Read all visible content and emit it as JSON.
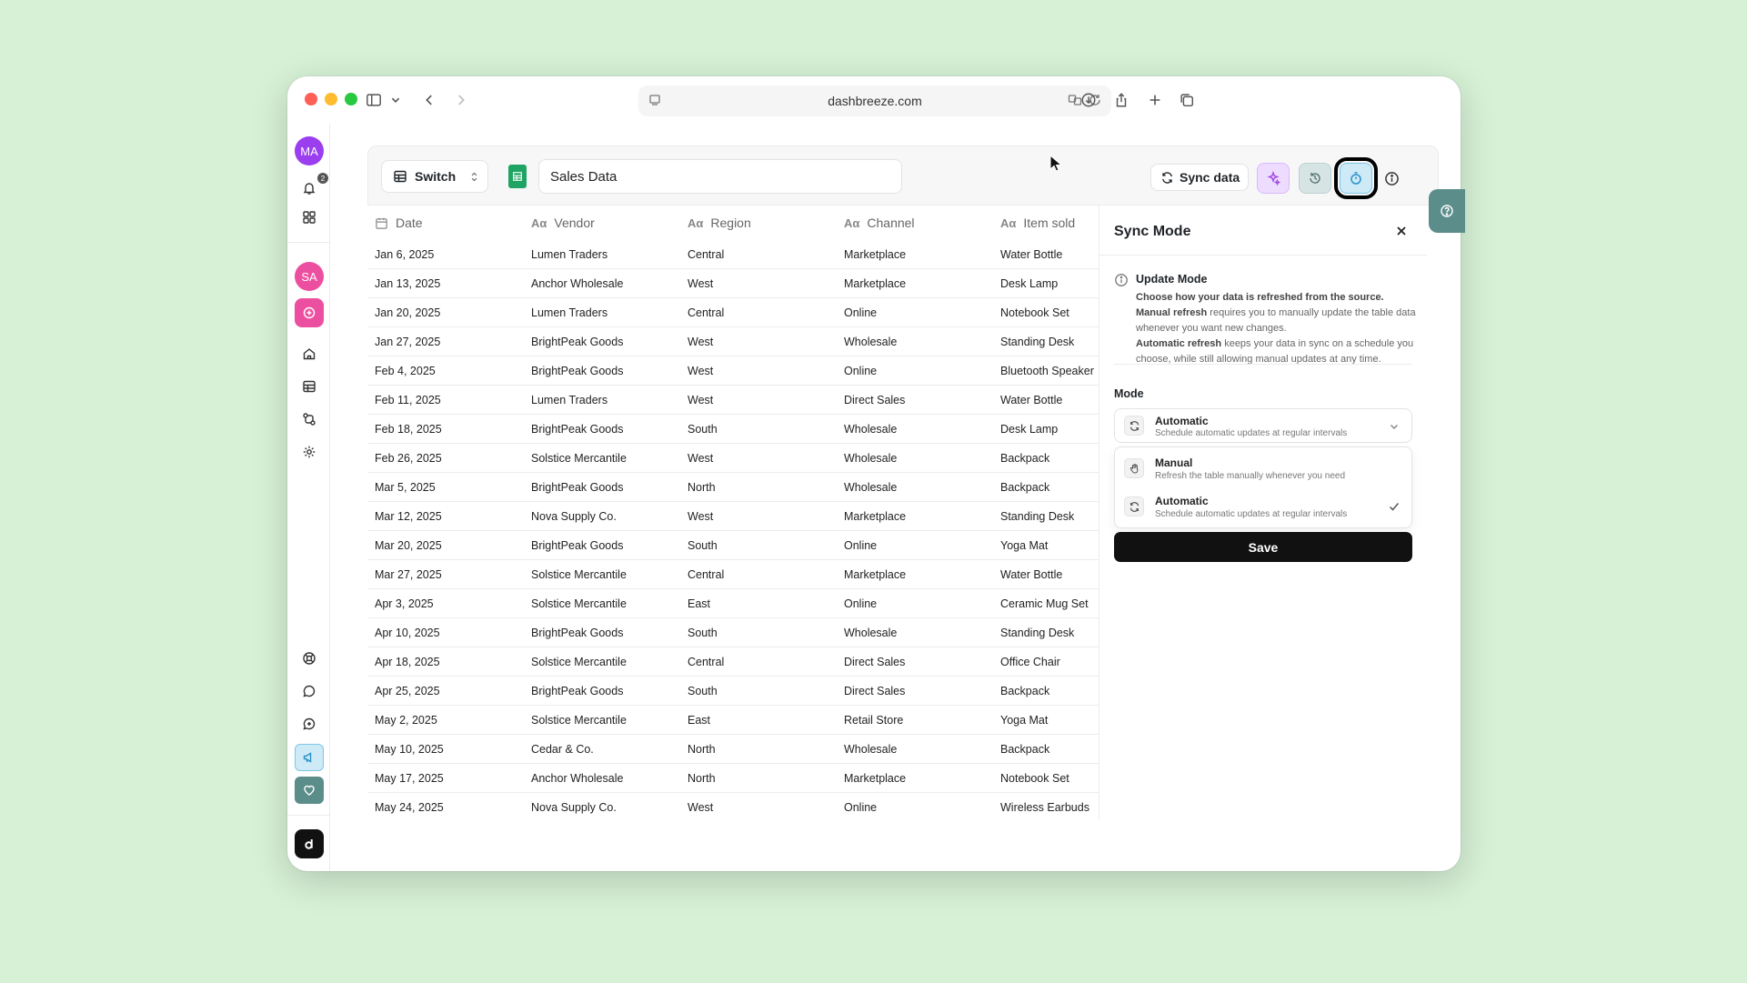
{
  "browser": {
    "url": "dashbreeze.com"
  },
  "rail": {
    "avatar_top": "MA",
    "notification_count": "2",
    "avatar_user": "SA",
    "colors": {
      "avatar_top": "#9b3ef0",
      "avatar_user": "#ec4f9f",
      "add_button": "#ec4f9f",
      "announce": "#cfeaf7",
      "heart": "#5b8d8a"
    }
  },
  "toolbar": {
    "switch_label": "Switch",
    "sheet_name": "Sales Data",
    "sync_label": "Sync data"
  },
  "table": {
    "columns": [
      "Date",
      "Vendor",
      "Region",
      "Channel",
      "Item sold"
    ],
    "rows": [
      [
        "Jan 6, 2025",
        "Lumen Traders",
        "Central",
        "Marketplace",
        "Water Bottle"
      ],
      [
        "Jan 13, 2025",
        "Anchor Wholesale",
        "West",
        "Marketplace",
        "Desk Lamp"
      ],
      [
        "Jan 20, 2025",
        "Lumen Traders",
        "Central",
        "Online",
        "Notebook Set"
      ],
      [
        "Jan 27, 2025",
        "BrightPeak Goods",
        "West",
        "Wholesale",
        "Standing Desk"
      ],
      [
        "Feb 4, 2025",
        "BrightPeak Goods",
        "West",
        "Online",
        "Bluetooth Speaker"
      ],
      [
        "Feb 11, 2025",
        "Lumen Traders",
        "West",
        "Direct Sales",
        "Water Bottle"
      ],
      [
        "Feb 18, 2025",
        "BrightPeak Goods",
        "South",
        "Wholesale",
        "Desk Lamp"
      ],
      [
        "Feb 26, 2025",
        "Solstice Mercantile",
        "West",
        "Wholesale",
        "Backpack"
      ],
      [
        "Mar 5, 2025",
        "BrightPeak Goods",
        "North",
        "Wholesale",
        "Backpack"
      ],
      [
        "Mar 12, 2025",
        "Nova Supply Co.",
        "West",
        "Marketplace",
        "Standing Desk"
      ],
      [
        "Mar 20, 2025",
        "BrightPeak Goods",
        "South",
        "Online",
        "Yoga Mat"
      ],
      [
        "Mar 27, 2025",
        "Solstice Mercantile",
        "Central",
        "Marketplace",
        "Water Bottle"
      ],
      [
        "Apr 3, 2025",
        "Solstice Mercantile",
        "East",
        "Online",
        "Ceramic Mug Set"
      ],
      [
        "Apr 10, 2025",
        "BrightPeak Goods",
        "South",
        "Wholesale",
        "Standing Desk"
      ],
      [
        "Apr 18, 2025",
        "Solstice Mercantile",
        "Central",
        "Direct Sales",
        "Office Chair"
      ],
      [
        "Apr 25, 2025",
        "BrightPeak Goods",
        "South",
        "Direct Sales",
        "Backpack"
      ],
      [
        "May 2, 2025",
        "Solstice Mercantile",
        "East",
        "Retail Store",
        "Yoga Mat"
      ],
      [
        "May 10, 2025",
        "Cedar & Co.",
        "North",
        "Wholesale",
        "Backpack"
      ],
      [
        "May 17, 2025",
        "Anchor Wholesale",
        "North",
        "Marketplace",
        "Notebook Set"
      ],
      [
        "May 24, 2025",
        "Nova Supply Co.",
        "West",
        "Online",
        "Wireless Earbuds"
      ]
    ]
  },
  "panel": {
    "title": "Sync Mode",
    "update_mode_title": "Update Mode",
    "desc_intro": "Choose how your data is refreshed from the source.",
    "desc_manual_bold": "Manual refresh",
    "desc_manual_rest": " requires you to manually update the table data whenever you want new changes.",
    "desc_auto_bold": "Automatic refresh",
    "desc_auto_rest": " keeps your data in sync on a schedule you choose, while still allowing manual updates at any time.",
    "mode_label": "Mode",
    "selected": {
      "title": "Automatic",
      "sub": "Schedule automatic updates at regular intervals"
    },
    "options": [
      {
        "title": "Manual",
        "sub": "Refresh the table manually whenever you need",
        "icon": "hand-icon",
        "checked": false
      },
      {
        "title": "Automatic",
        "sub": "Schedule automatic updates at regular intervals",
        "icon": "refresh-icon",
        "checked": true
      }
    ],
    "save_label": "Save"
  }
}
